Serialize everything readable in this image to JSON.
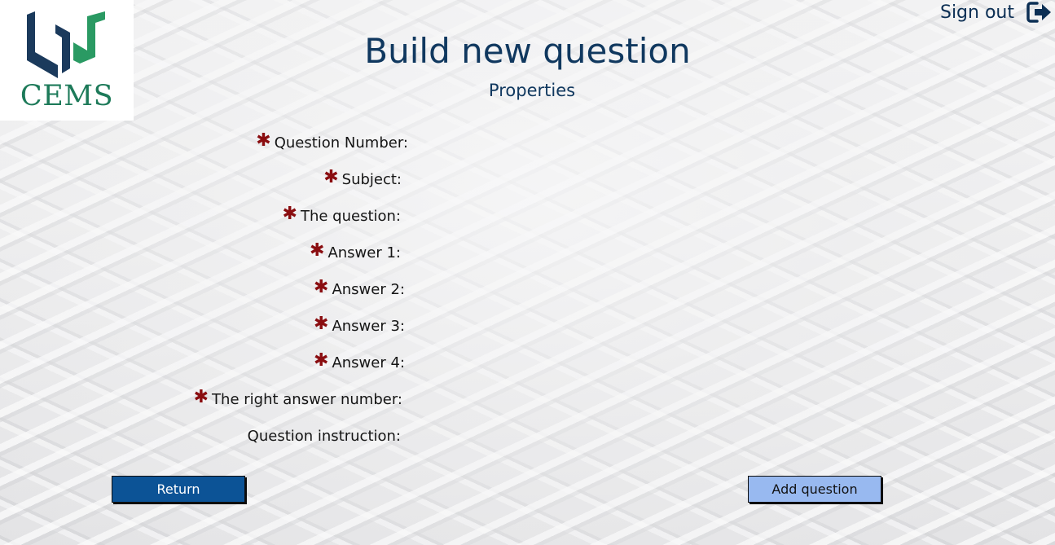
{
  "brand": {
    "logo_text": "CEMS"
  },
  "header": {
    "signout_label": "Sign out",
    "signout_icon": "sign-out-icon"
  },
  "page": {
    "title": "Build new question",
    "subtitle": "Properties"
  },
  "form": {
    "fields": [
      {
        "label": "Question Number:",
        "required": true
      },
      {
        "label": "Subject:",
        "required": true
      },
      {
        "label": "The question:",
        "required": true
      },
      {
        "label": "Answer 1:",
        "required": true
      },
      {
        "label": "Answer 2:",
        "required": true
      },
      {
        "label": "Answer 3:",
        "required": true
      },
      {
        "label": "Answer 4:",
        "required": true
      },
      {
        "label": "The right answer number:",
        "required": true
      },
      {
        "label": "Question instruction:",
        "required": false
      }
    ],
    "required_marker": "✱"
  },
  "actions": {
    "return_label": "Return",
    "add_label": "Add question"
  },
  "colors": {
    "brand_navy": "#1b3a5c",
    "brand_green": "#1d7a59",
    "title": "#10385f",
    "required": "#8a0d10",
    "return_button": "#0c5396",
    "add_button": "#98b9f0"
  }
}
